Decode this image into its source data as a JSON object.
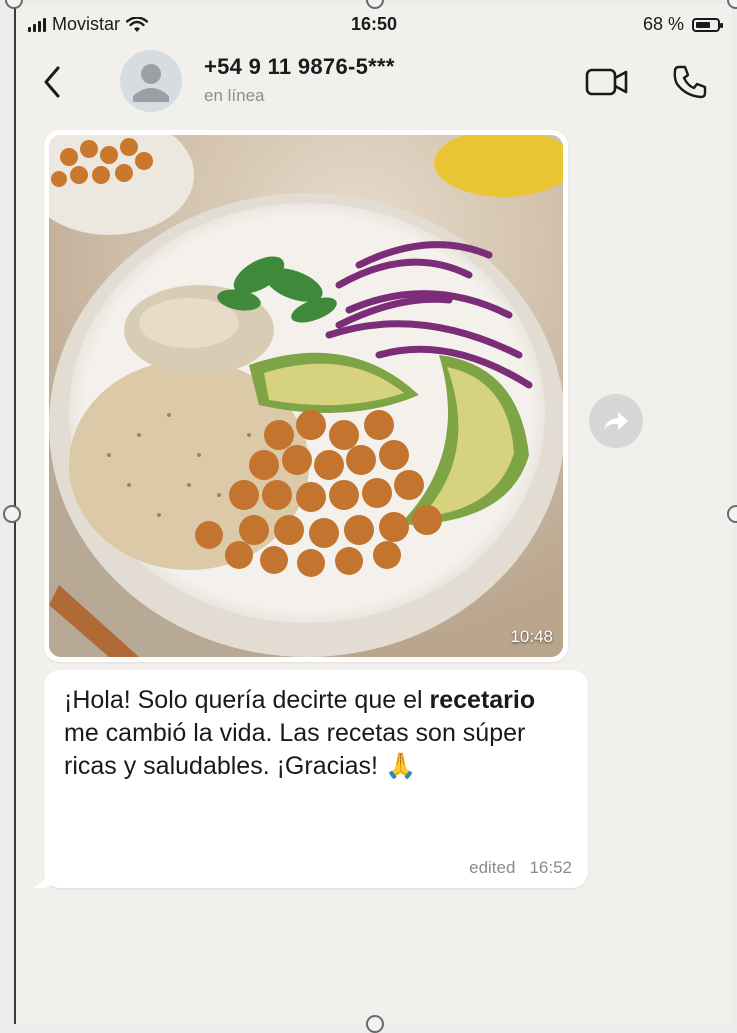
{
  "status_bar": {
    "carrier": "Movistar",
    "time": "16:50",
    "battery_percent": "68 %",
    "battery_level": 0.68
  },
  "header": {
    "contact_name": "+54 9 11 9876-5***",
    "contact_status": "en línea",
    "icons": [
      "back-arrow-icon",
      "avatar-placeholder-icon",
      "video-call-icon",
      "phone-icon"
    ]
  },
  "messages": [
    {
      "type": "image",
      "time": "10:48",
      "image_content": "food-bowl-photo"
    },
    {
      "type": "text",
      "text_part1": "¡Hola! Solo quería decirte que el",
      "text_bold": "recetario",
      "text_part2": "me cambió la vida. Las recetas son súper ricas y saludables. ¡Gracias!",
      "emoji": "🙏",
      "edited_label": "edited",
      "time": "16:52"
    }
  ],
  "colors": {
    "chat_background": "#f1f0ed",
    "bubble_background": "#ffffff",
    "meta_text": "#8b8b8b"
  }
}
